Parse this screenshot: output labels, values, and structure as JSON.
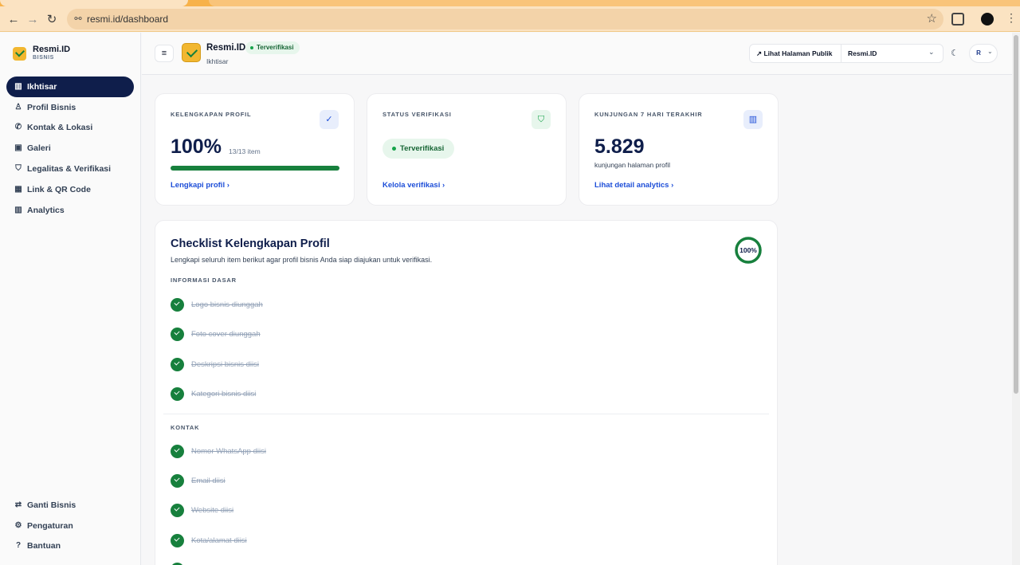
{
  "browser": {
    "url": "resmi.id/dashboard",
    "back_icon": "←",
    "forward_icon": "→",
    "reload_icon": "↻",
    "star_icon": "☆",
    "menu_icon": "⋮"
  },
  "sidebar": {
    "brand_name": "Resmi.ID",
    "brand_sub": "BISNIS",
    "items": [
      {
        "label": "Ikhtisar",
        "icon": "▥"
      },
      {
        "label": "Profil Bisnis",
        "icon": "♙"
      },
      {
        "label": "Kontak & Lokasi",
        "icon": "✆"
      },
      {
        "label": "Galeri",
        "icon": "▣"
      },
      {
        "label": "Legalitas & Verifikasi",
        "icon": "⛉"
      },
      {
        "label": "Link & QR Code",
        "icon": "▦"
      },
      {
        "label": "Analytics",
        "icon": "▥"
      }
    ],
    "bottom_items": [
      {
        "label": "Ganti Bisnis",
        "icon": "⇄"
      },
      {
        "label": "Pengaturan",
        "icon": "⚙"
      },
      {
        "label": "Bantuan",
        "icon": "?"
      }
    ]
  },
  "header": {
    "menu_icon": "≡",
    "title": "Resmi.ID",
    "badge": "Terverifikasi",
    "subtitle": "Ikhtisar",
    "public_link": "↗ Lihat Halaman Publik",
    "business_select": "Resmi.ID",
    "chevron": "⌄",
    "theme_icon": "☾",
    "user_initial": "R"
  },
  "cards": {
    "completeness": {
      "label": "KELENGKAPAN PROFIL",
      "value": "100%",
      "meta": "13/13 item",
      "progress": 1.0,
      "link": "Lengkapi profil ›",
      "icon": "✓"
    },
    "verification": {
      "label": "STATUS VERIFIKASI",
      "status": "Terverifikasi",
      "link": "Kelola verifikasi ›",
      "icon": "⛉"
    },
    "visits": {
      "label": "KUNJUNGAN 7 HARI TERAKHIR",
      "value": "5.829",
      "note": "kunjungan halaman profil",
      "link": "Lihat detail analytics ›",
      "icon": "▥"
    }
  },
  "checklist": {
    "title": "Checklist Kelengkapan Profil",
    "description": "Lengkapi seluruh item berikut agar profil bisnis Anda siap diajukan untuk verifikasi.",
    "percent": "100%",
    "progress": 1.0,
    "sections": [
      {
        "title": "INFORMASI DASAR",
        "items": [
          "Logo bisnis diunggah",
          "Foto cover diunggah",
          "Deskripsi bisnis diisi",
          "Kategori bisnis diisi"
        ]
      },
      {
        "title": "KONTAK",
        "items": [
          "Nomor WhatsApp diisi",
          "Email diisi",
          "Website diisi",
          "Kota/alamat diisi"
        ]
      }
    ]
  },
  "colors": {
    "accent_navy": "#0f1e4b",
    "success_green": "#17803d",
    "link_blue": "#1d4ed8",
    "brand_yellow": "#f2b730"
  }
}
